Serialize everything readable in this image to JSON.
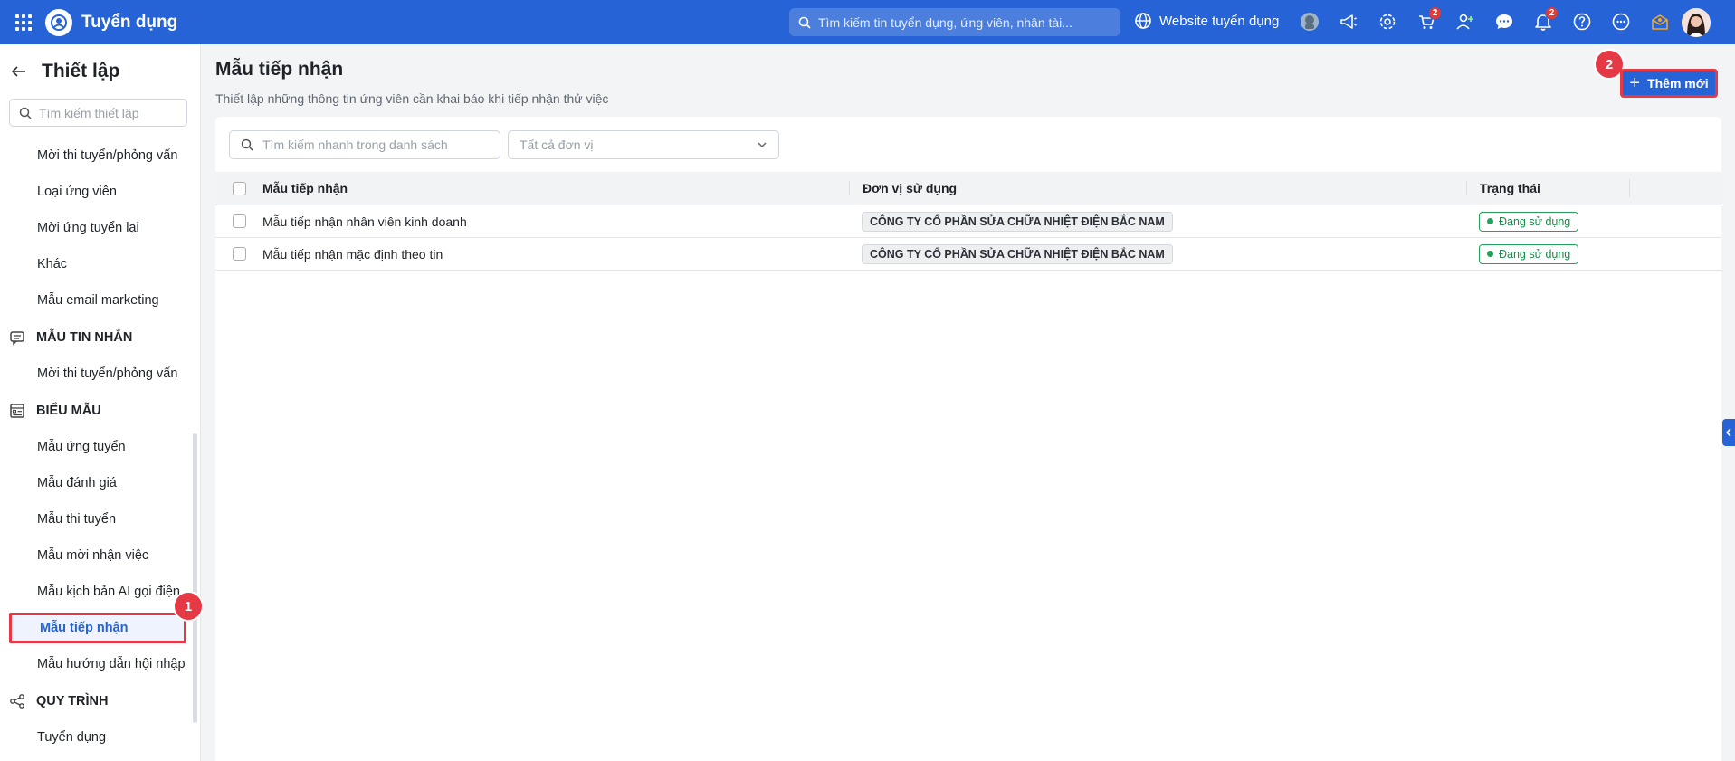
{
  "header": {
    "app_title": "Tuyển dụng",
    "search_placeholder": "Tìm kiếm tin tuyển dụng, ứng viên, nhân tài...",
    "website_label": "Website tuyển dụng",
    "cart_badge": "2",
    "notification_badge": "2"
  },
  "sidebar": {
    "title": "Thiết lập",
    "search_placeholder": "Tìm kiếm thiết lập",
    "items_top": [
      "Mời thi tuyển/phỏng vấn",
      "Loại ứng viên",
      "Mời ứng tuyển lại",
      "Khác",
      "Mẫu email marketing"
    ],
    "section_messages": "MẪU TIN NHẮN",
    "items_messages": [
      "Mời thi tuyển/phỏng vấn"
    ],
    "section_forms": "BIỂU MẪU",
    "items_forms": [
      "Mẫu ứng tuyển",
      "Mẫu đánh giá",
      "Mẫu thi tuyển",
      "Mẫu mời nhận việc",
      "Mẫu kịch bản AI gọi điện"
    ],
    "active_item": "Mẫu tiếp nhận",
    "item_after_active": "Mẫu hướng dẫn hội nhập",
    "section_process": "QUY TRÌNH",
    "items_process": [
      "Tuyển dụng"
    ]
  },
  "main": {
    "title": "Mẫu tiếp nhận",
    "subtitle": "Thiết lập những thông tin ứng viên cần khai báo khi tiếp nhận thử việc",
    "add_button": "Thêm mới",
    "filter_search_placeholder": "Tìm kiếm nhanh trong danh sách",
    "filter_unit_placeholder": "Tất cả đơn vị",
    "table": {
      "columns": [
        "Mẫu tiếp nhận",
        "Đơn vị sử dụng",
        "Trạng thái"
      ],
      "rows": [
        {
          "name": "Mẫu tiếp nhận nhân viên kinh doanh",
          "unit": "CÔNG TY CỔ PHẦN SỬA CHỮA NHIỆT ĐIỆN BẮC NAM",
          "status": "Đang sử dụng"
        },
        {
          "name": "Mẫu tiếp nhận mặc định theo tin",
          "unit": "CÔNG TY CỔ PHẦN SỬA CHỮA NHIỆT ĐIỆN BẮC NAM",
          "status": "Đang sử dụng"
        }
      ]
    }
  },
  "annotations": {
    "step1": "1",
    "step2": "2"
  },
  "colors": {
    "primary": "#2563d6",
    "highlight": "#e53945",
    "status_green": "#22a35a"
  }
}
